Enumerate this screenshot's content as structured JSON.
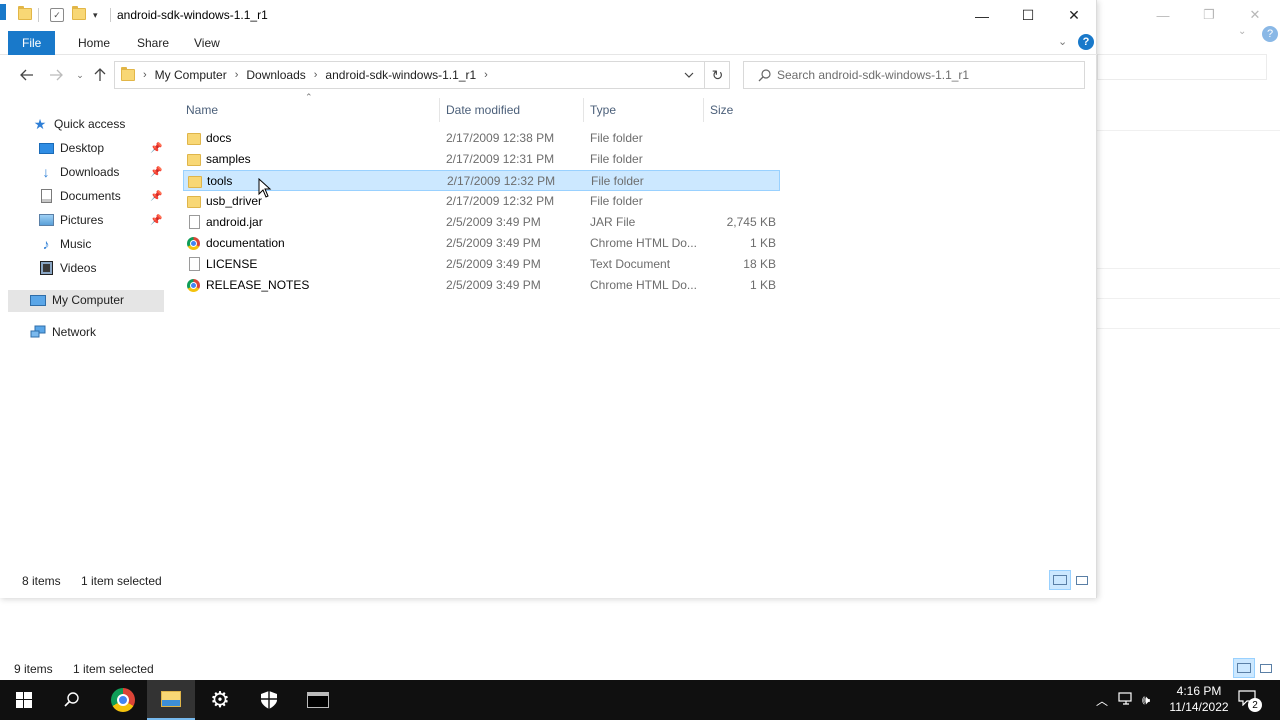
{
  "window": {
    "title": "android-sdk-windows-1.1_r1",
    "minimize_glyph": "—",
    "maximize_glyph": "☐",
    "close_glyph": "✕"
  },
  "ribbon": {
    "tabs": [
      {
        "label": "File"
      },
      {
        "label": "Home"
      },
      {
        "label": "Share"
      },
      {
        "label": "View"
      }
    ],
    "help_glyph": "?"
  },
  "address": {
    "crumbs": [
      "My Computer",
      "Downloads",
      "android-sdk-windows-1.1_r1"
    ],
    "separator": "›",
    "search_placeholder": "Search android-sdk-windows-1.1_r1"
  },
  "nav": {
    "items": [
      {
        "label": "Quick access",
        "icon": "star-icon",
        "color": "#2f7fd6"
      },
      {
        "label": "Desktop",
        "icon": "desktop-icon",
        "pinned": true
      },
      {
        "label": "Downloads",
        "icon": "download-icon",
        "pinned": true
      },
      {
        "label": "Documents",
        "icon": "documents-icon",
        "pinned": true
      },
      {
        "label": "Pictures",
        "icon": "pictures-icon",
        "pinned": true
      },
      {
        "label": "Music",
        "icon": "music-icon"
      },
      {
        "label": "Videos",
        "icon": "videos-icon"
      },
      {
        "label": "My Computer",
        "icon": "computer-icon",
        "selected": true
      },
      {
        "label": "Network",
        "icon": "network-icon"
      }
    ]
  },
  "columns": [
    {
      "label": "Name"
    },
    {
      "label": "Date modified"
    },
    {
      "label": "Type"
    },
    {
      "label": "Size"
    }
  ],
  "files": [
    {
      "name": "docs",
      "date": "2/17/2009 12:38 PM",
      "type": "File folder",
      "size": "",
      "icon": "folder-icon"
    },
    {
      "name": "samples",
      "date": "2/17/2009 12:31 PM",
      "type": "File folder",
      "size": "",
      "icon": "folder-icon"
    },
    {
      "name": "tools",
      "date": "2/17/2009 12:32 PM",
      "type": "File folder",
      "size": "",
      "icon": "folder-icon",
      "selected": true
    },
    {
      "name": "usb_driver",
      "date": "2/17/2009 12:32 PM",
      "type": "File folder",
      "size": "",
      "icon": "folder-icon"
    },
    {
      "name": "android.jar",
      "date": "2/5/2009 3:49 PM",
      "type": "JAR File",
      "size": "2,745 KB",
      "icon": "file-icon"
    },
    {
      "name": "documentation",
      "date": "2/5/2009 3:49 PM",
      "type": "Chrome HTML Do...",
      "size": "1 KB",
      "icon": "chrome-icon"
    },
    {
      "name": "LICENSE",
      "date": "2/5/2009 3:49 PM",
      "type": "Text Document",
      "size": "18 KB",
      "icon": "text-file-icon"
    },
    {
      "name": "RELEASE_NOTES",
      "date": "2/5/2009 3:49 PM",
      "type": "Chrome HTML Do...",
      "size": "1 KB",
      "icon": "chrome-icon"
    }
  ],
  "status": {
    "item_count": "8 items",
    "selected_count": "1 item selected"
  },
  "background_window": {
    "item_count": "9 items",
    "selected_count": "1 item selected"
  },
  "taskbar": {
    "time": "4:16 PM",
    "date": "11/14/2022",
    "notification_count": "2",
    "accent": "#76b9ed"
  }
}
